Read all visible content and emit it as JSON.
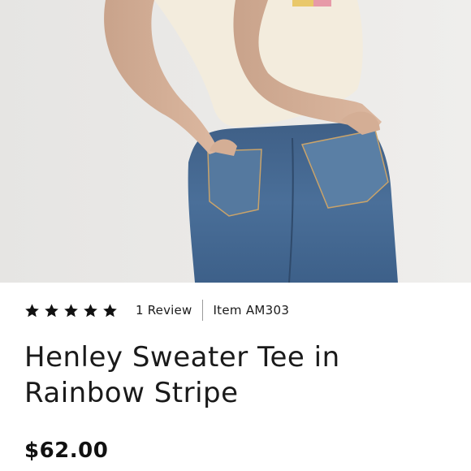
{
  "product": {
    "rating_stars": 5,
    "reviews_label": "1 Review",
    "item_label": "Item AM303",
    "title": "Henley Sweater Tee in Rainbow Stripe",
    "price": "$62.00"
  },
  "icons": {
    "star": "star-icon"
  },
  "colors": {
    "background": "#ffffff",
    "photo_background": "#ecebe9",
    "text": "#1a1a1a"
  }
}
